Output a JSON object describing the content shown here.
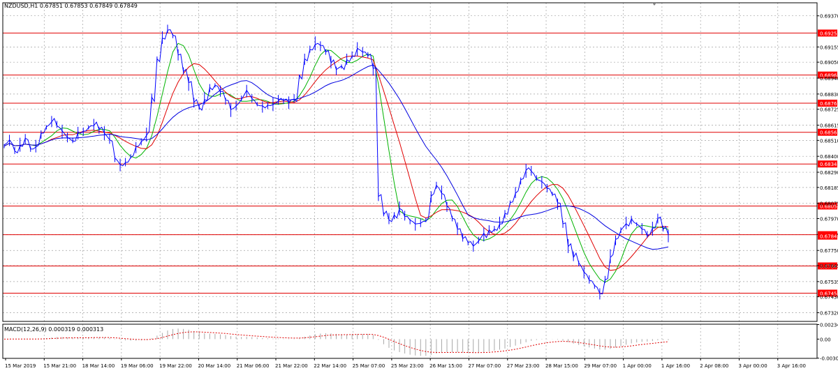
{
  "chart_data": {
    "type": "line",
    "instrument_line": "NZDUSD,H1  0.67851 0.67853 0.67849 0.67849",
    "y_ticks": [
      "0.69370",
      "0.69155",
      "0.69050",
      "0.68940",
      "0.68830",
      "0.68725",
      "0.68615",
      "0.68510",
      "0.68400",
      "0.68290",
      "0.68185",
      "0.68075",
      "0.67970",
      "0.67860",
      "0.67750",
      "0.67645",
      "0.67535",
      "0.67430",
      "0.67320"
    ],
    "ylim": [
      0.6726,
      0.6946
    ],
    "horizontal_levels": [
      "0.69251",
      "0.68961",
      "0.68767",
      "0.68566",
      "0.68347",
      "0.68057",
      "0.67859",
      "0.67643",
      "0.67455"
    ],
    "current_price_label": "0.67849",
    "x_ticks": [
      "15 Mar 2019",
      "15 Mar 21:00",
      "18 Mar 14:00",
      "19 Mar 06:00",
      "19 Mar 22:00",
      "20 Mar 14:00",
      "21 Mar 06:00",
      "21 Mar 22:00",
      "22 Mar 14:00",
      "25 Mar 07:00",
      "25 Mar 23:00",
      "26 Mar 15:00",
      "27 Mar 07:00",
      "27 Mar 23:00",
      "28 Mar 15:00",
      "29 Mar 07:00",
      "1 Apr 00:00",
      "1 Apr 16:00",
      "2 Apr 08:00",
      "3 Apr 00:00",
      "3 Apr 16:00"
    ],
    "price_series": [
      0.6847,
      0.6851,
      0.6844,
      0.6848,
      0.6852,
      0.6845,
      0.6847,
      0.6855,
      0.686,
      0.6864,
      0.6862,
      0.6857,
      0.6853,
      0.6851,
      0.6856,
      0.6857,
      0.686,
      0.6862,
      0.6858,
      0.6856,
      0.6852,
      0.6838,
      0.6834,
      0.6836,
      0.684,
      0.6846,
      0.685,
      0.6855,
      0.688,
      0.6907,
      0.6922,
      0.6928,
      0.6923,
      0.691,
      0.6899,
      0.689,
      0.6877,
      0.6874,
      0.688,
      0.6887,
      0.6889,
      0.6885,
      0.6878,
      0.6872,
      0.6875,
      0.688,
      0.6885,
      0.688,
      0.6876,
      0.6874,
      0.6875,
      0.6876,
      0.6879,
      0.6878,
      0.6877,
      0.688,
      0.6895,
      0.6907,
      0.6914,
      0.6918,
      0.6916,
      0.6912,
      0.6905,
      0.6899,
      0.6902,
      0.6907,
      0.691,
      0.6914,
      0.6912,
      0.691,
      0.69,
      0.6812,
      0.68,
      0.6797,
      0.6799,
      0.6804,
      0.6799,
      0.6795,
      0.6793,
      0.6794,
      0.6796,
      0.6812,
      0.682,
      0.6815,
      0.6805,
      0.6797,
      0.679,
      0.6784,
      0.678,
      0.6778,
      0.6782,
      0.6786,
      0.6789,
      0.679,
      0.6794,
      0.68,
      0.6808,
      0.6815,
      0.6823,
      0.683,
      0.683,
      0.6825,
      0.6822,
      0.6818,
      0.6814,
      0.6807,
      0.6793,
      0.6778,
      0.6771,
      0.6766,
      0.676,
      0.6755,
      0.675,
      0.6745,
      0.6755,
      0.6771,
      0.6782,
      0.6789,
      0.6794,
      0.6796,
      0.6793,
      0.679,
      0.6786,
      0.679,
      0.6797,
      0.679,
      0.6785
    ],
    "moving_averages": [
      {
        "color": "#00b300",
        "period": 5
      },
      {
        "color": "#e00000",
        "period": 9
      },
      {
        "color": "#0000e0",
        "period": 18
      }
    ],
    "macd": {
      "label": "MACD(12,26,9) 0.000319 0.000313",
      "y_ticks": [
        "0.002344",
        "0.00",
        "-0.003071"
      ],
      "ylim": [
        -0.0031,
        0.0024
      ]
    },
    "grid": true,
    "colors": {
      "price": "#0000ff",
      "level": "#e00000",
      "level_label_bg": "#ff0000",
      "grid": "#a0a0a0",
      "current_label_bg": "#ff0000",
      "macd_hist": "#a8a8a8",
      "macd_signal": "#e00000"
    }
  }
}
